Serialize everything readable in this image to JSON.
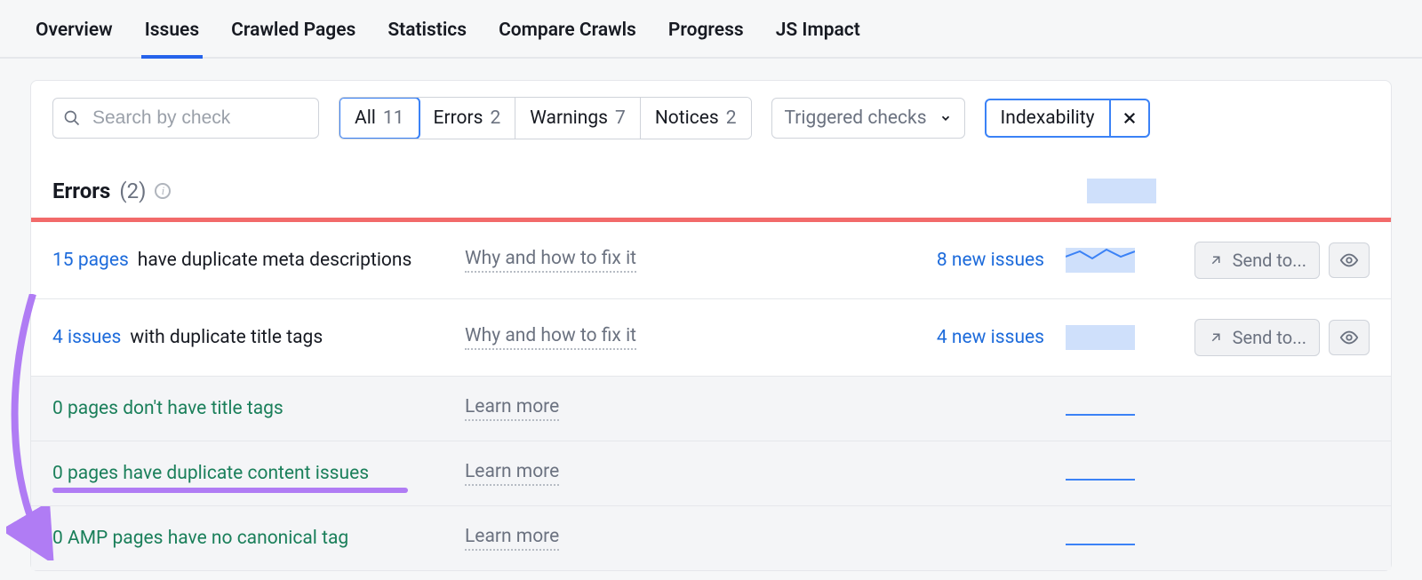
{
  "tabs": {
    "items": [
      {
        "label": "Overview",
        "active": false
      },
      {
        "label": "Issues",
        "active": true
      },
      {
        "label": "Crawled Pages",
        "active": false
      },
      {
        "label": "Statistics",
        "active": false
      },
      {
        "label": "Compare Crawls",
        "active": false
      },
      {
        "label": "Progress",
        "active": false
      },
      {
        "label": "JS Impact",
        "active": false
      }
    ]
  },
  "search": {
    "placeholder": "Search by check"
  },
  "category_filters": {
    "all": {
      "label": "All",
      "count": "11"
    },
    "errors": {
      "label": "Errors",
      "count": "2"
    },
    "warnings": {
      "label": "Warnings",
      "count": "7"
    },
    "notices": {
      "label": "Notices",
      "count": "2"
    }
  },
  "triggered_checks_label": "Triggered checks",
  "filter_chip": {
    "label": "Indexability"
  },
  "section": {
    "title": "Errors",
    "count": "(2)"
  },
  "errors_rows": [
    {
      "count_label": "15 pages",
      "rest": "have duplicate meta descriptions",
      "why": "Why and how to fix it",
      "new_issues": "8 new issues",
      "spark": "area",
      "send_label": "Send to..."
    },
    {
      "count_label": "4 issues",
      "rest": "with duplicate title tags",
      "why": "Why and how to fix it",
      "new_issues": "4 new issues",
      "spark": "flat-fill",
      "send_label": "Send to..."
    }
  ],
  "zero_rows": [
    {
      "text": "0 pages don't have title tags",
      "learn": "Learn more"
    },
    {
      "text": "0 pages have duplicate content issues",
      "learn": "Learn more",
      "highlight": true
    },
    {
      "text": "0 AMP pages have no canonical tag",
      "learn": "Learn more"
    }
  ]
}
